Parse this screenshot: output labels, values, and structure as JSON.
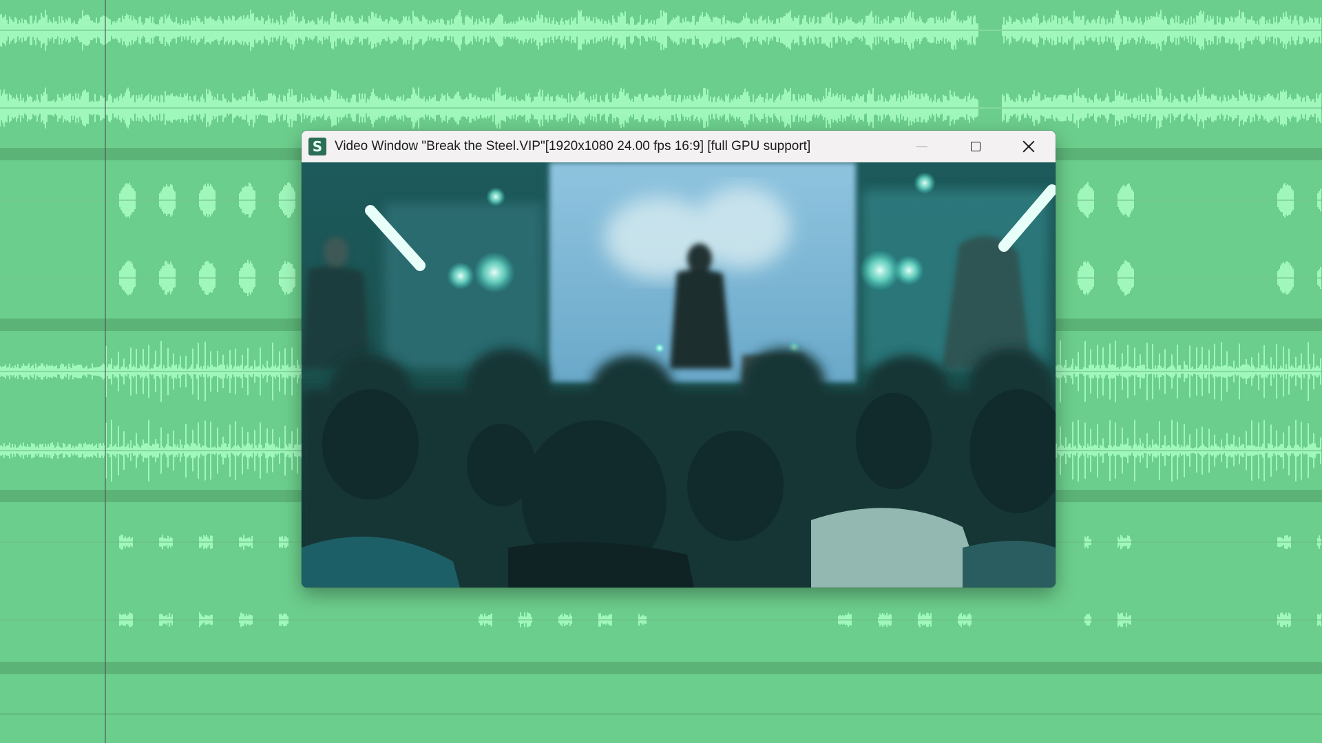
{
  "window": {
    "title": "Video Window \"Break the Steel.VIP\"[1920x1080 24.00 fps 16:9]  [full GPU support]",
    "app_icon_letter": "S",
    "app_icon": "sound-forge-app-icon",
    "minimize_icon": "minimize-icon",
    "maximize_icon": "maximize-icon",
    "close_icon": "close-icon"
  },
  "video": {
    "scene": "concert-crowd-frame"
  },
  "colors": {
    "background": "#6cce8c",
    "waveform": "#9ff7bb",
    "waveform_dark": "#3f8a57",
    "divider": "#5cb377",
    "accent": "#2b6e55"
  }
}
